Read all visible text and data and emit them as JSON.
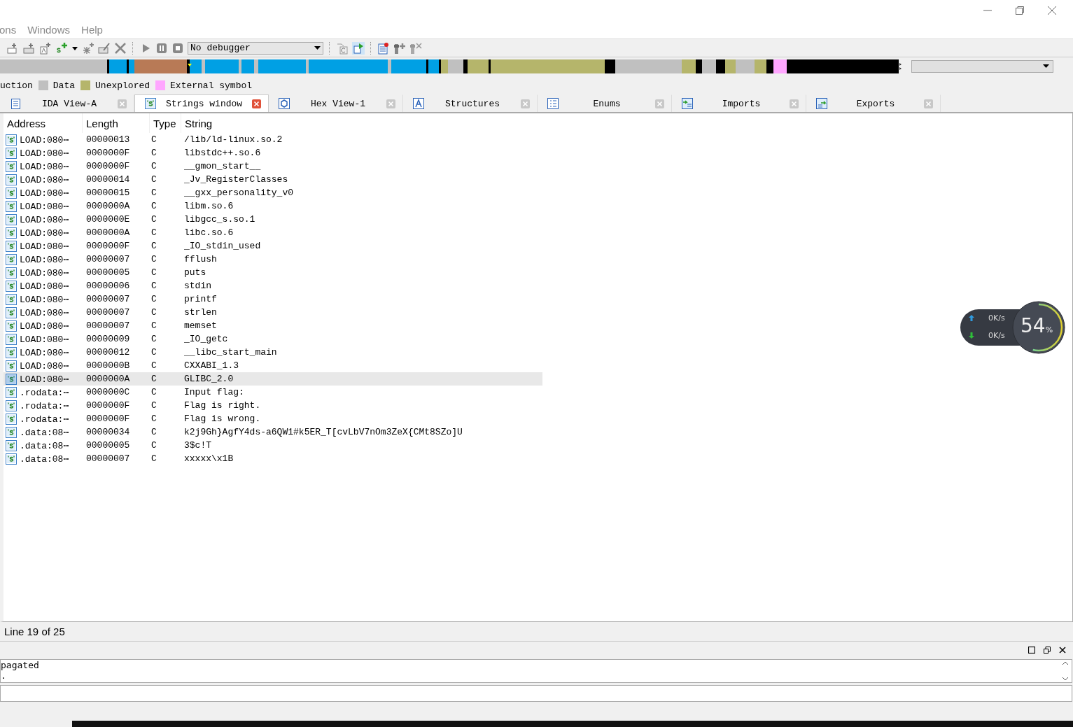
{
  "menu": [
    "ons",
    "Windows",
    "Help"
  ],
  "toolbar": {
    "debugger": "No debugger"
  },
  "legend": [
    {
      "label": "uction"
    },
    {
      "label": "Data",
      "color": "#c0c0c0"
    },
    {
      "label": "Unexplored",
      "color": "#b5b56b"
    },
    {
      "label": "External symbol",
      "color": "#ffa6ff"
    }
  ],
  "tabs": [
    {
      "label": "IDA View-A",
      "kind": "disasm",
      "selected": false
    },
    {
      "label": "Strings window",
      "kind": "strings",
      "selected": true
    },
    {
      "label": "Hex View-1",
      "kind": "hex",
      "selected": false
    },
    {
      "label": "Structures",
      "kind": "struct",
      "selected": false
    },
    {
      "label": "Enums",
      "kind": "enum",
      "selected": false
    },
    {
      "label": "Imports",
      "kind": "imports",
      "selected": false
    },
    {
      "label": "Exports",
      "kind": "exports",
      "selected": false
    }
  ],
  "table": {
    "columns": [
      "Address",
      "Length",
      "Type",
      "String"
    ],
    "rows": [
      {
        "address": "LOAD:080⋯",
        "length": "00000013",
        "type": "C",
        "string": "/lib/ld-linux.so.2",
        "selected": false
      },
      {
        "address": "LOAD:080⋯",
        "length": "0000000F",
        "type": "C",
        "string": "libstdc++.so.6",
        "selected": false
      },
      {
        "address": "LOAD:080⋯",
        "length": "0000000F",
        "type": "C",
        "string": "__gmon_start__",
        "selected": false
      },
      {
        "address": "LOAD:080⋯",
        "length": "00000014",
        "type": "C",
        "string": "_Jv_RegisterClasses",
        "selected": false
      },
      {
        "address": "LOAD:080⋯",
        "length": "00000015",
        "type": "C",
        "string": "__gxx_personality_v0",
        "selected": false
      },
      {
        "address": "LOAD:080⋯",
        "length": "0000000A",
        "type": "C",
        "string": "libm.so.6",
        "selected": false
      },
      {
        "address": "LOAD:080⋯",
        "length": "0000000E",
        "type": "C",
        "string": "libgcc_s.so.1",
        "selected": false
      },
      {
        "address": "LOAD:080⋯",
        "length": "0000000A",
        "type": "C",
        "string": "libc.so.6",
        "selected": false
      },
      {
        "address": "LOAD:080⋯",
        "length": "0000000F",
        "type": "C",
        "string": "_IO_stdin_used",
        "selected": false
      },
      {
        "address": "LOAD:080⋯",
        "length": "00000007",
        "type": "C",
        "string": "fflush",
        "selected": false
      },
      {
        "address": "LOAD:080⋯",
        "length": "00000005",
        "type": "C",
        "string": "puts",
        "selected": false
      },
      {
        "address": "LOAD:080⋯",
        "length": "00000006",
        "type": "C",
        "string": "stdin",
        "selected": false
      },
      {
        "address": "LOAD:080⋯",
        "length": "00000007",
        "type": "C",
        "string": "printf",
        "selected": false
      },
      {
        "address": "LOAD:080⋯",
        "length": "00000007",
        "type": "C",
        "string": "strlen",
        "selected": false
      },
      {
        "address": "LOAD:080⋯",
        "length": "00000007",
        "type": "C",
        "string": "memset",
        "selected": false
      },
      {
        "address": "LOAD:080⋯",
        "length": "00000009",
        "type": "C",
        "string": "_IO_getc",
        "selected": false
      },
      {
        "address": "LOAD:080⋯",
        "length": "00000012",
        "type": "C",
        "string": "__libc_start_main",
        "selected": false
      },
      {
        "address": "LOAD:080⋯",
        "length": "0000000B",
        "type": "C",
        "string": "CXXABI_1.3",
        "selected": false
      },
      {
        "address": "LOAD:080⋯",
        "length": "0000000A",
        "type": "C",
        "string": "GLIBC_2.0",
        "selected": true
      },
      {
        "address": ".rodata:⋯",
        "length": "0000000C",
        "type": "C",
        "string": "Input flag:",
        "selected": false
      },
      {
        "address": ".rodata:⋯",
        "length": "0000000F",
        "type": "C",
        "string": "Flag is right.",
        "selected": false
      },
      {
        "address": ".rodata:⋯",
        "length": "0000000F",
        "type": "C",
        "string": "Flag is wrong.",
        "selected": false
      },
      {
        "address": ".data:08⋯",
        "length": "00000034",
        "type": "C",
        "string": "k2j9Gh}AgfY4ds-a6QW1#k5ER_T[cvLbV7nOm3ZeX{CMt8SZo]U",
        "selected": false
      },
      {
        "address": ".data:08⋯",
        "length": "00000005",
        "type": "C",
        "string": "3$c!T",
        "selected": false
      },
      {
        "address": ".data:08⋯",
        "length": "00000007",
        "type": "C",
        "string": "xxxxx\\x1B",
        "selected": false
      }
    ]
  },
  "status_bar": "Line 19 of 25",
  "output": {
    "lines": [
      "pagated",
      "."
    ]
  },
  "net_meter": {
    "upload": "0K/s",
    "download": "0K/s",
    "percent": "54",
    "unit": "%",
    "level": 0.54
  }
}
